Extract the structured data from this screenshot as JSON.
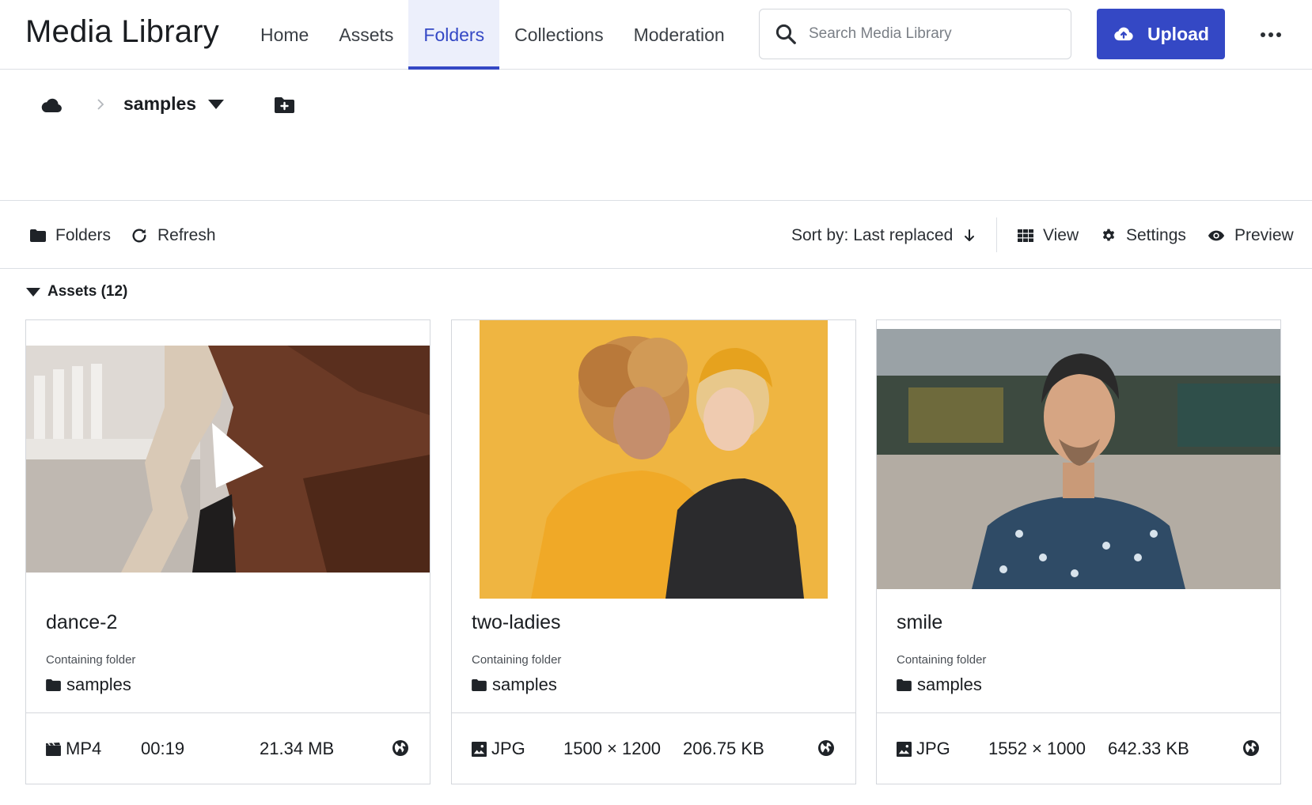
{
  "header": {
    "app_title": "Media Library",
    "nav": [
      {
        "label": "Home",
        "active": false
      },
      {
        "label": "Assets",
        "active": false
      },
      {
        "label": "Folders",
        "active": true
      },
      {
        "label": "Collections",
        "active": false
      },
      {
        "label": "Moderation",
        "active": false
      }
    ],
    "search_placeholder": "Search Media Library",
    "upload_label": "Upload",
    "accent_color": "#3448c5"
  },
  "breadcrumb": {
    "current_folder": "samples"
  },
  "toolbar": {
    "folders_label": "Folders",
    "refresh_label": "Refresh",
    "sort_label": "Sort by: Last replaced",
    "view_label": "View",
    "settings_label": "Settings",
    "preview_label": "Preview"
  },
  "assets": {
    "heading": "Assets (12)",
    "items": [
      {
        "name": "dance-2",
        "folder_caption": "Containing folder",
        "folder": "samples",
        "format": "MP4",
        "detail": "00:19",
        "size": "21.34 MB",
        "type_icon": "video-icon"
      },
      {
        "name": "two-ladies",
        "folder_caption": "Containing folder",
        "folder": "samples",
        "format": "JPG",
        "detail": "1500 × 1200",
        "size": "206.75 KB",
        "type_icon": "image-icon"
      },
      {
        "name": "smile",
        "folder_caption": "Containing folder",
        "folder": "samples",
        "format": "JPG",
        "detail": "1552 × 1000",
        "size": "642.33 KB",
        "type_icon": "image-icon"
      }
    ]
  }
}
